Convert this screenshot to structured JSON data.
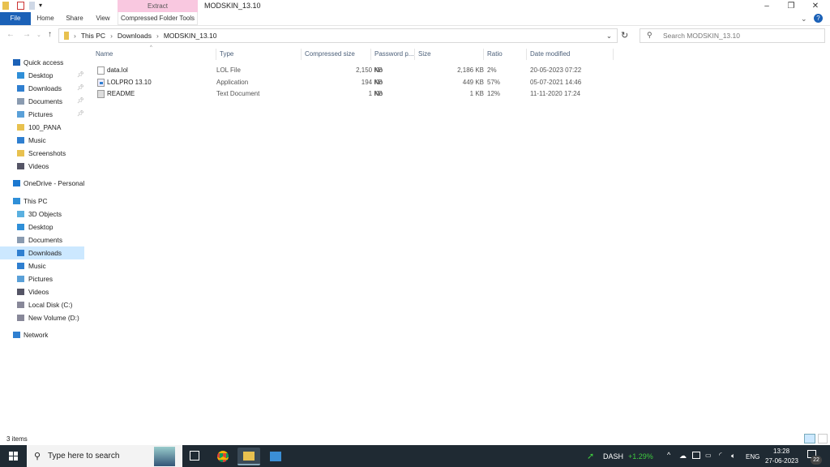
{
  "window": {
    "title": "MODSKIN_13.10",
    "context_tab": "Extract",
    "context_group": "Compressed Folder Tools"
  },
  "ribbon": {
    "tabs": [
      "File",
      "Home",
      "Share",
      "View"
    ]
  },
  "address": {
    "crumbs": [
      "This PC",
      "Downloads",
      "MODSKIN_13.10"
    ],
    "search_placeholder": "Search MODSKIN_13.10"
  },
  "sidebar": {
    "items": [
      {
        "label": "Quick access",
        "icon": "star-icon",
        "top": true
      },
      {
        "label": "Desktop",
        "icon": "desktop-icon",
        "pinned": true
      },
      {
        "label": "Downloads",
        "icon": "download-icon",
        "pinned": true
      },
      {
        "label": "Documents",
        "icon": "documents-icon",
        "pinned": true
      },
      {
        "label": "Pictures",
        "icon": "pictures-icon",
        "pinned": true
      },
      {
        "label": "100_PANA",
        "icon": "folder-icon"
      },
      {
        "label": "Music",
        "icon": "music-icon"
      },
      {
        "label": "Screenshots",
        "icon": "folder-icon"
      },
      {
        "label": "Videos",
        "icon": "videos-icon"
      },
      {
        "label": "OneDrive - Personal",
        "icon": "cloud-icon",
        "top": true
      },
      {
        "label": "This PC",
        "icon": "computer-icon",
        "top": true
      },
      {
        "label": "3D Objects",
        "icon": "cube-icon"
      },
      {
        "label": "Desktop",
        "icon": "desktop-icon"
      },
      {
        "label": "Documents",
        "icon": "documents-icon"
      },
      {
        "label": "Downloads",
        "icon": "download-icon",
        "selected": true
      },
      {
        "label": "Music",
        "icon": "music-icon"
      },
      {
        "label": "Pictures",
        "icon": "pictures-icon"
      },
      {
        "label": "Videos",
        "icon": "videos-icon"
      },
      {
        "label": "Local Disk (C:)",
        "icon": "drive-icon"
      },
      {
        "label": "New Volume (D:)",
        "icon": "drive-icon"
      },
      {
        "label": "Network",
        "icon": "network-icon",
        "top": true
      }
    ]
  },
  "columns": [
    "Name",
    "Type",
    "Compressed size",
    "Password p...",
    "Size",
    "Ratio",
    "Date modified"
  ],
  "files": [
    {
      "name": "data.lol",
      "type": "LOL File",
      "compressed": "2,150 KB",
      "password": "No",
      "size": "2,186 KB",
      "ratio": "2%",
      "modified": "20-05-2023 07:22",
      "icon": "file-icon"
    },
    {
      "name": "LOLPRO 13.10",
      "type": "Application",
      "compressed": "194 KB",
      "password": "No",
      "size": "449 KB",
      "ratio": "57%",
      "modified": "05-07-2021 14:46",
      "icon": "application-icon"
    },
    {
      "name": "README",
      "type": "Text Document",
      "compressed": "1 KB",
      "password": "No",
      "size": "1 KB",
      "ratio": "12%",
      "modified": "11-11-2020 17:24",
      "icon": "text-document-icon"
    }
  ],
  "status": {
    "items": "3 items"
  },
  "taskbar": {
    "search_placeholder": "Type here to search",
    "ticker": "DASH",
    "change": "+1.29%",
    "lang": "ENG",
    "time": "13:28",
    "date": "27-06-2023",
    "notifications": "22"
  },
  "colors": {
    "accent": "#1b61b7",
    "context": "#f9c8e0",
    "selected": "#cce8ff",
    "taskbar": "#1f2a33",
    "gain": "#3fc93f"
  }
}
